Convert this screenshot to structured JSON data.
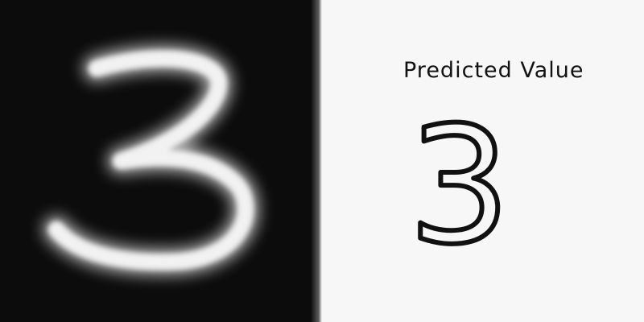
{
  "input_panel": {
    "digit_image": "handwritten-digit-3",
    "background_color": "#0c0c0c",
    "stroke_color": "#f0f0f0"
  },
  "result_panel": {
    "title": "Predicted Value",
    "predicted_value": "3",
    "text_color": "#111111",
    "background_color": "#f7f7f7"
  }
}
